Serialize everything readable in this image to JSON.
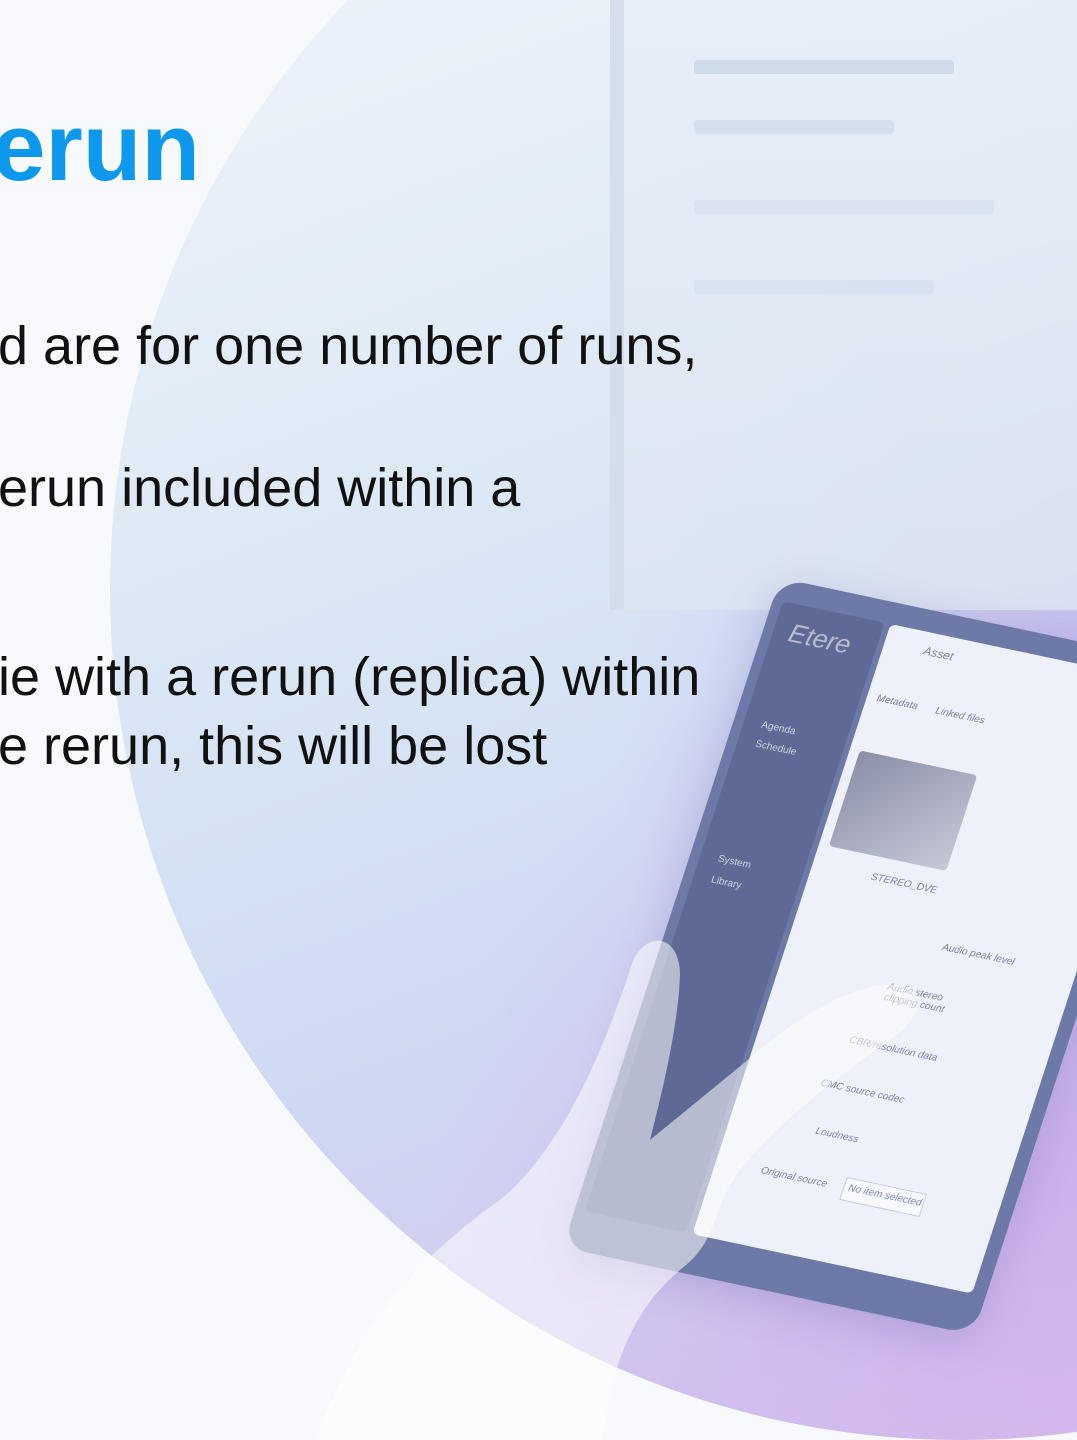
{
  "slide": {
    "title": "erun",
    "paragraphs": [
      {
        "lines": [
          "d are for one number of runs,",
          "erun included within a"
        ]
      },
      {
        "lines": [
          "ie with a rerun (replica) within",
          "e rerun, this will be lost"
        ]
      }
    ]
  },
  "background_photo": {
    "description_icon": "tablet-with-hand-photo",
    "tablet_logo": "Etere",
    "sidebar_items": [
      "Agenda",
      "Schedule",
      "System",
      "Library"
    ],
    "screen_tabs": [
      "Asset",
      "Metadata",
      "Linked files"
    ],
    "field_labels": [
      "Audio peak level",
      "Audio stereo clipping count",
      "CBR/resolution data",
      "CMC source codec",
      "Loudness",
      "Original source"
    ],
    "field_value": "No item selected",
    "thumb_caption": "STEREO_DVE"
  },
  "colors": {
    "title": "#0c98ec",
    "body": "#111111",
    "accent_pink": "#f078dc"
  }
}
